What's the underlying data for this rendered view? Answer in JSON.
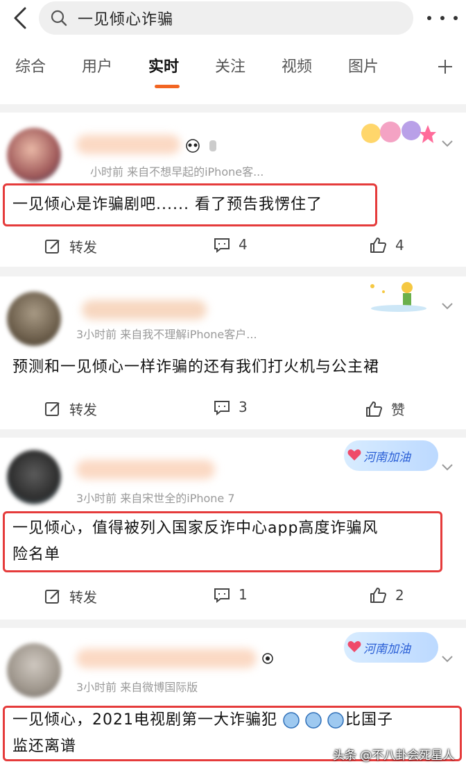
{
  "search": {
    "query": "一见倾心诈骗"
  },
  "tabs": [
    "综合",
    "用户",
    "实时",
    "关注",
    "视频",
    "图片"
  ],
  "active_tab": "实时",
  "posts": [
    {
      "meta": "小时前  来自不想早起的iPhone客...",
      "content_lines": [
        "一见倾心是诈骗剧吧...... 看了预告我愣住了"
      ],
      "highlighted": true,
      "repost_label": "转发",
      "comments": "4",
      "likes": "4"
    },
    {
      "meta": "3小时前  来自我不理解iPhone客户...",
      "content_lines": [
        "预测和一见倾心一样诈骗的还有我们打火机与公主裙"
      ],
      "highlighted": false,
      "repost_label": "转发",
      "comments": "3",
      "likes": "赞"
    },
    {
      "meta": "3小时前  来自宋世全的iPhone 7",
      "badge_text": "河南加油",
      "content_lines": [
        "一见倾心，值得被列入国家反诈中心app高度诈骗风",
        "险名单"
      ],
      "highlighted": true,
      "repost_label": "转发",
      "comments": "1",
      "likes": "2"
    },
    {
      "meta": "3小时前  来自微博国际版",
      "badge_text": "河南加油",
      "content_lines": [
        "一见倾心，2021电视剧第一大诈骗犯",
        "监还离谱"
      ],
      "content_tail": "比国子",
      "highlighted": true
    }
  ],
  "watermark": "头条 @不八卦会死星人",
  "colors": {
    "accent": "#f26522",
    "highlight_box": "#e53b3b"
  }
}
